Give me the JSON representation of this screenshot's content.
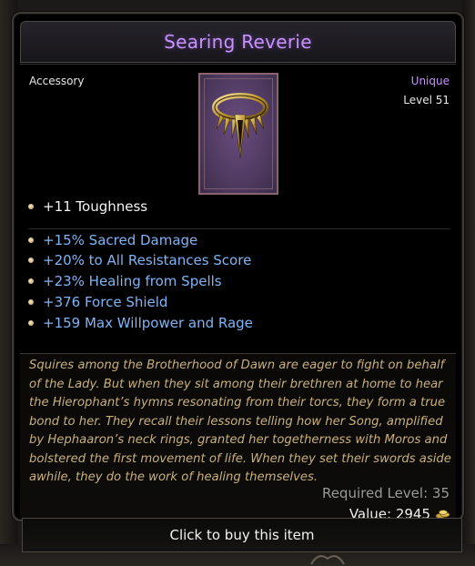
{
  "item": {
    "name": "Searing Reverie",
    "type": "Accessory",
    "rarity": "Unique",
    "level": "Level 51",
    "base_stats": [
      "+11 Toughness"
    ],
    "mod_stats": [
      "+15% Sacred Damage",
      "+20% to All Resistances Score",
      "+23% Healing from Spells",
      "+376 Force Shield",
      "+159 Max Willpower and Rage"
    ],
    "lore": "Squires among the Brotherhood of Dawn are eager to fight on behalf of the Lady. But when they sit among their brethren at home to hear the Hierophant’s hymns resonating from their torcs, they form a true bond to her. They recall their lessons telling how her Song, amplified by Hephaaron’s neck rings, granted her togetherness with Moros and bolstered the first movement of life. When they set their swords aside awhile, they do the work of healing themselves.",
    "required_level": "Required Level: 35",
    "value": "Value: 2945",
    "icon": "necklace-torc-icon"
  },
  "actions": {
    "buy_label": "Click to buy this item"
  },
  "colors": {
    "unique": "#c892ff",
    "mod": "#7fb4f5",
    "lore": "#c8b07a"
  }
}
